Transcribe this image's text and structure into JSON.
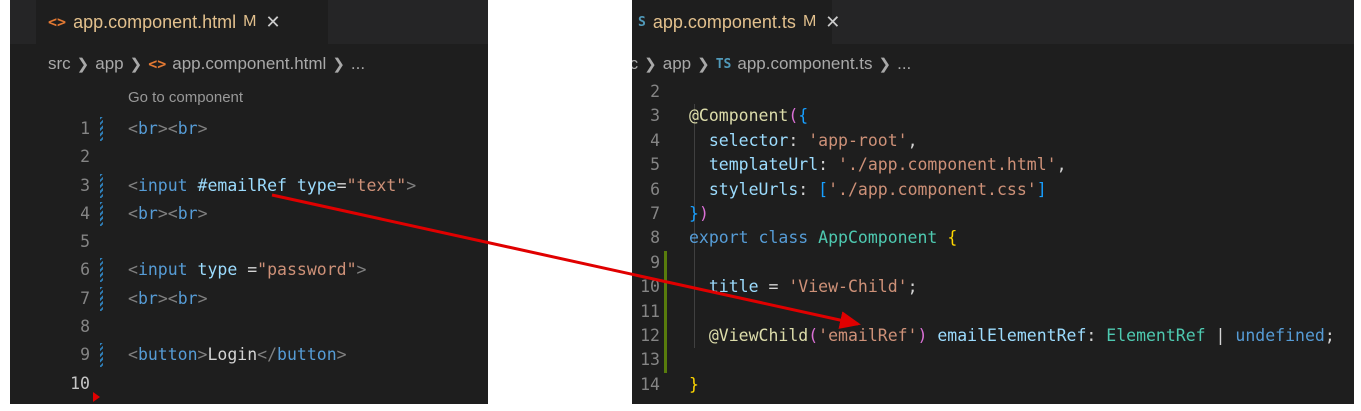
{
  "left_editor": {
    "tab": {
      "icon": "html-icon",
      "filename": "app.component.html",
      "status": "M",
      "close": "✕"
    },
    "breadcrumb": [
      "src",
      "app",
      "app.component.html",
      "..."
    ],
    "codelens": "Go to component",
    "lines": [
      {
        "n": "1",
        "tokens": [
          [
            "<",
            "br"
          ],
          [
            "br",
            "tag"
          ],
          [
            ">",
            "br"
          ],
          [
            "<",
            "br"
          ],
          [
            "br",
            "tag"
          ],
          [
            ">",
            "br"
          ]
        ]
      },
      {
        "n": "2",
        "tokens": []
      },
      {
        "n": "3",
        "tokens": [
          [
            "<",
            "br"
          ],
          [
            "input",
            "tag"
          ],
          [
            " ",
            "plain"
          ],
          [
            "#emailRef",
            "attr"
          ],
          [
            " ",
            "plain"
          ],
          [
            "type",
            "attr"
          ],
          [
            "=",
            "plain"
          ],
          [
            "\"text\"",
            "str"
          ],
          [
            ">",
            "br"
          ]
        ]
      },
      {
        "n": "4",
        "tokens": [
          [
            "<",
            "br"
          ],
          [
            "br",
            "tag"
          ],
          [
            ">",
            "br"
          ],
          [
            "<",
            "br"
          ],
          [
            "br",
            "tag"
          ],
          [
            ">",
            "br"
          ]
        ]
      },
      {
        "n": "5",
        "tokens": []
      },
      {
        "n": "6",
        "tokens": [
          [
            "<",
            "br"
          ],
          [
            "input",
            "tag"
          ],
          [
            " ",
            "plain"
          ],
          [
            "type",
            "attr"
          ],
          [
            " =",
            "plain"
          ],
          [
            "\"password\"",
            "str"
          ],
          [
            ">",
            "br"
          ]
        ]
      },
      {
        "n": "7",
        "tokens": [
          [
            "<",
            "br"
          ],
          [
            "br",
            "tag"
          ],
          [
            ">",
            "br"
          ],
          [
            "<",
            "br"
          ],
          [
            "br",
            "tag"
          ],
          [
            ">",
            "br"
          ]
        ]
      },
      {
        "n": "8",
        "tokens": []
      },
      {
        "n": "9",
        "tokens": [
          [
            "<",
            "br"
          ],
          [
            "button",
            "tag"
          ],
          [
            ">",
            "br"
          ],
          [
            "Login",
            "plain"
          ],
          [
            "</",
            "br"
          ],
          [
            "button",
            "tag"
          ],
          [
            ">",
            "br"
          ]
        ]
      },
      {
        "n": "10",
        "tokens": []
      }
    ]
  },
  "right_editor": {
    "tab": {
      "icon": "typescript-icon",
      "icon_text": "S",
      "filename": "app.component.ts",
      "status": "M",
      "close": "✕"
    },
    "breadcrumb": [
      "rc",
      "app",
      "app.component.ts",
      "..."
    ],
    "breadcrumb_icon_text": "TS",
    "lines": [
      {
        "n": "2",
        "tokens": []
      },
      {
        "n": "3",
        "tokens": [
          [
            "@Component",
            "dec"
          ],
          [
            "(",
            "paren"
          ],
          [
            "{",
            "sq"
          ]
        ]
      },
      {
        "n": "4",
        "tokens": [
          [
            "  selector",
            "attr"
          ],
          [
            ": ",
            "plain"
          ],
          [
            "'app-root'",
            "str"
          ],
          [
            ",",
            "plain"
          ]
        ]
      },
      {
        "n": "5",
        "tokens": [
          [
            "  templateUrl",
            "attr"
          ],
          [
            ": ",
            "plain"
          ],
          [
            "'./app.component.html'",
            "str"
          ],
          [
            ",",
            "plain"
          ]
        ]
      },
      {
        "n": "6",
        "tokens": [
          [
            "  styleUrls",
            "attr"
          ],
          [
            ": ",
            "plain"
          ],
          [
            "[",
            "sq"
          ],
          [
            "'./app.component.css'",
            "str"
          ],
          [
            "]",
            "sq"
          ]
        ]
      },
      {
        "n": "7",
        "tokens": [
          [
            "}",
            "sq"
          ],
          [
            ")",
            "paren"
          ]
        ]
      },
      {
        "n": "8",
        "tokens": [
          [
            "export",
            "kw"
          ],
          [
            " ",
            "plain"
          ],
          [
            "class",
            "kw"
          ],
          [
            " ",
            "plain"
          ],
          [
            "AppComponent",
            "cls"
          ],
          [
            " ",
            "plain"
          ],
          [
            "{",
            "brace"
          ]
        ]
      },
      {
        "n": "9",
        "tokens": [],
        "changed": true
      },
      {
        "n": "10",
        "tokens": [
          [
            "  title",
            "attr"
          ],
          [
            " = ",
            "plain"
          ],
          [
            "'View-Child'",
            "str"
          ],
          [
            ";",
            "plain"
          ]
        ],
        "changed": true
      },
      {
        "n": "11",
        "tokens": [],
        "changed": true
      },
      {
        "n": "12",
        "tokens": [
          [
            "  @ViewChild",
            "dec"
          ],
          [
            "(",
            "paren"
          ],
          [
            "'emailRef'",
            "str"
          ],
          [
            ")",
            "paren"
          ],
          [
            " ",
            "plain"
          ],
          [
            "emailElementRef",
            "attr"
          ],
          [
            ": ",
            "plain"
          ],
          [
            "ElementRef",
            "cls"
          ],
          [
            " | ",
            "plain"
          ],
          [
            "undefined",
            "kw"
          ],
          [
            ";",
            "plain"
          ]
        ],
        "changed": true
      },
      {
        "n": "13",
        "tokens": [],
        "changed": true
      },
      {
        "n": "14",
        "tokens": [
          [
            "}",
            "brace"
          ]
        ]
      }
    ]
  },
  "colors": {
    "annotation_arrow": "#e00000",
    "editor_bg": "#1e1e1e",
    "modified_tab": "#e2c08d",
    "diff_added": "#587c0c"
  }
}
